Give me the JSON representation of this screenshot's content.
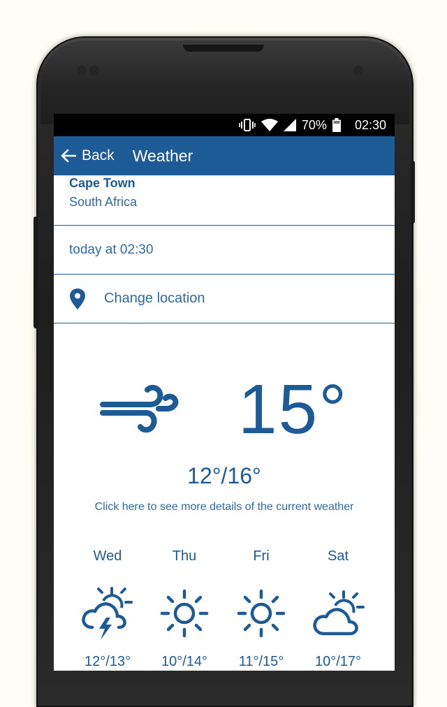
{
  "status_bar": {
    "battery": "70%",
    "time": "02:30"
  },
  "app_bar": {
    "back_label": "Back",
    "title": "Weather"
  },
  "location": {
    "city": "Cape Town",
    "country": "South Africa"
  },
  "updated": "today at 02:30",
  "change_location_label": "Change location",
  "current": {
    "icon": "wind-icon",
    "temperature": "15°",
    "min_max": "12°/16°",
    "details_link": "Click here to see more details of the current weather"
  },
  "forecast": [
    {
      "day": "Wed",
      "icon": "thunderstorm-partly-sunny-icon",
      "range": "12°/13°"
    },
    {
      "day": "Thu",
      "icon": "sun-icon",
      "range": "10°/14°"
    },
    {
      "day": "Fri",
      "icon": "sun-icon",
      "range": "11°/15°"
    },
    {
      "day": "Sat",
      "icon": "partly-cloudy-icon",
      "range": "10°/17°"
    }
  ],
  "colors": {
    "primary": "#1c5b96",
    "text_link": "#2e6aa4",
    "status_bar": "#000000"
  }
}
